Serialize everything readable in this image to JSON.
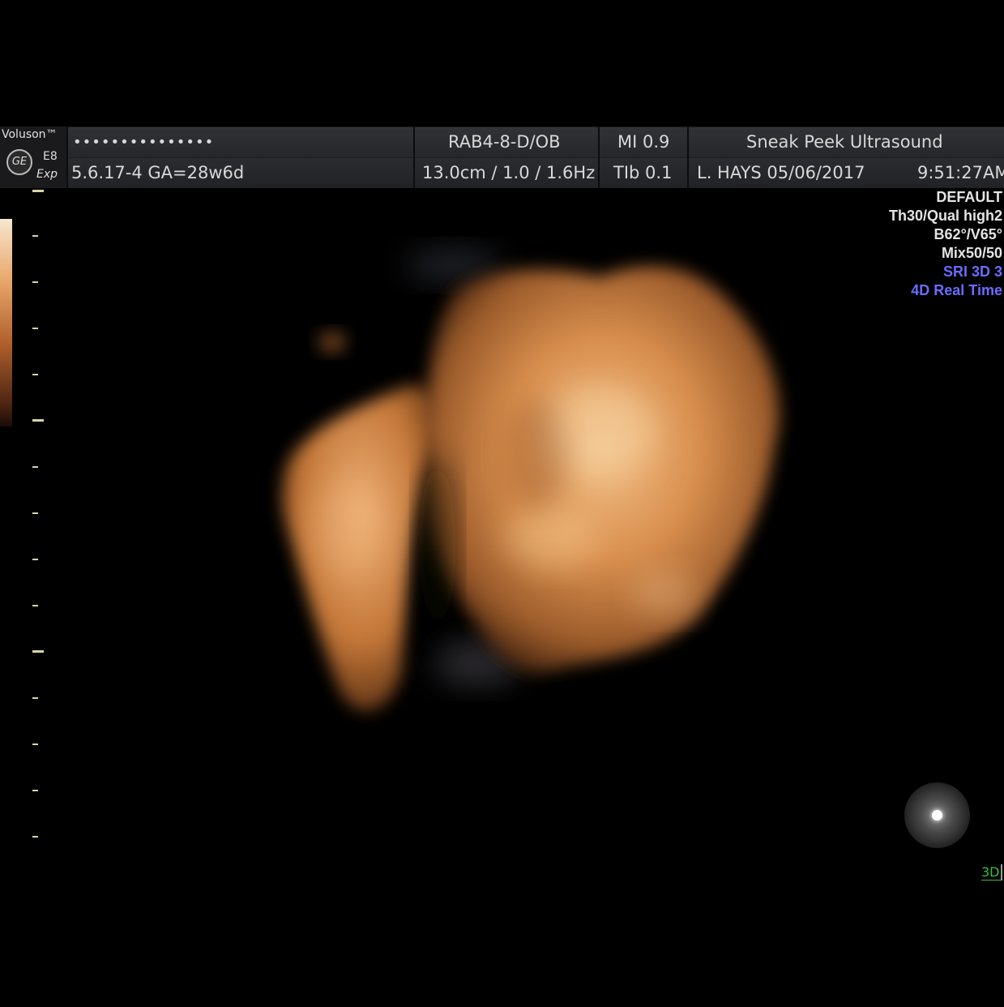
{
  "header": {
    "brand": "Voluson™",
    "model": "E8",
    "model_sub": "Exp",
    "patient_id": "•••••••••••••••",
    "exam": "5.6.17-4  GA=28w6d",
    "probe": "RAB4-8-D/OB",
    "depth_freq": "13.0cm / 1.0 / 1.6Hz",
    "mi": "MI  0.9",
    "tib": "TIb  0.1",
    "clinic": "Sneak Peek Ultrasound",
    "operator_date": "L. HAYS  05/06/2017",
    "time": "9:51:27AM"
  },
  "params": {
    "preset": "DEFAULT",
    "quality": "Th30/Qual high2",
    "angles": "B62°/V65°",
    "mix": "Mix50/50",
    "sri": "SRI 3D 3",
    "mode": "4D Real Time"
  },
  "mode_indicator": "3D",
  "colors": {
    "header_bg": "#25272a",
    "accent_blue": "#6a6cff",
    "mode_green": "#3dbd3d",
    "render_tone": "#e39a5a"
  }
}
